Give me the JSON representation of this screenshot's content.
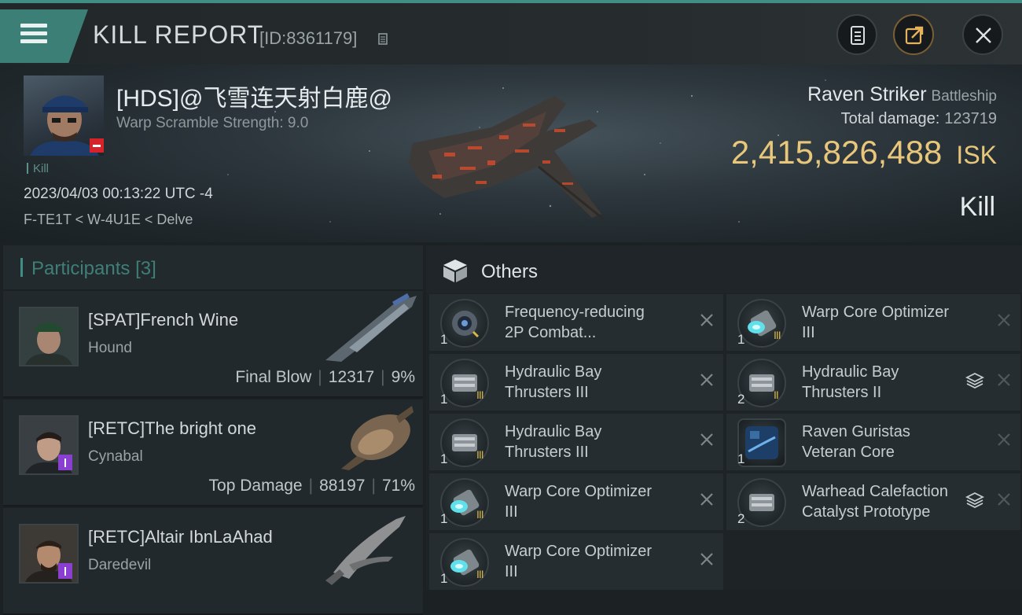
{
  "header": {
    "title": "KILL REPORT",
    "report_id": "[ID:8361179]"
  },
  "victim": {
    "name": "[HDS]@飞雪连天射白鹿@",
    "scramble": "Warp Scramble Strength: 9.0",
    "kill_tag": "Kill",
    "timestamp": "2023/04/03 00:13:22 UTC -4",
    "location": "F-TE1T < W-4U1E < Delve",
    "ship": "Raven Striker",
    "ship_class": "Battleship",
    "total_damage_label": "Total damage:",
    "total_damage": "123719",
    "isk_value": "2,415,826,488",
    "isk_unit": "ISK",
    "result": "Kill",
    "colors": {
      "accent": "#3f8f84",
      "isk": "#e8c77b",
      "status_badge": "#d6232a"
    }
  },
  "participants": {
    "title": "Participants",
    "count": "[3]",
    "list": [
      {
        "name": "[SPAT]French Wine",
        "ship": "Hound",
        "role": "Final Blow",
        "damage": "12317",
        "percent": "9%"
      },
      {
        "name": "[RETC]The bright one",
        "ship": "Cynabal",
        "role": "Top Damage",
        "damage": "88197",
        "percent": "71%"
      },
      {
        "name": "[RETC]Altair IbnLaAhad",
        "ship": "Daredevil"
      }
    ]
  },
  "others": {
    "title": "Others",
    "left": [
      {
        "line1": "Frequency-reducing",
        "line2": "2P Combat...",
        "qty": "1",
        "meta": "",
        "icon": "scanner-module-icon"
      },
      {
        "line1": "Hydraulic Bay",
        "line2": "Thrusters III",
        "qty": "1",
        "meta": "III",
        "icon": "thruster-module-icon"
      },
      {
        "line1": "Hydraulic Bay",
        "line2": "Thrusters III",
        "qty": "1",
        "meta": "III",
        "icon": "thruster-module-icon"
      },
      {
        "line1": "Warp Core Optimizer",
        "line2": "III",
        "qty": "1",
        "meta": "III",
        "icon": "warp-core-module-icon"
      },
      {
        "line1": "Warp Core Optimizer",
        "line2": "III",
        "qty": "1",
        "meta": "III",
        "icon": "warp-core-module-icon"
      }
    ],
    "right": [
      {
        "line1": "Warp Core Optimizer",
        "line2": "III",
        "qty": "1",
        "meta": "III",
        "icon": "warp-core-module-icon"
      },
      {
        "line1": "Hydraulic Bay",
        "line2": "Thrusters II",
        "qty": "2",
        "meta": "II",
        "icon": "thruster-module-icon",
        "stacked": true
      },
      {
        "line1": "Raven Guristas",
        "line2": "Veteran Core",
        "qty": "1",
        "meta": "",
        "icon": "core-module-icon"
      },
      {
        "line1": "Warhead Calefaction",
        "line2": "Catalyst Prototype",
        "qty": "2",
        "meta": "",
        "icon": "thruster-module-icon",
        "stacked": true
      }
    ]
  }
}
